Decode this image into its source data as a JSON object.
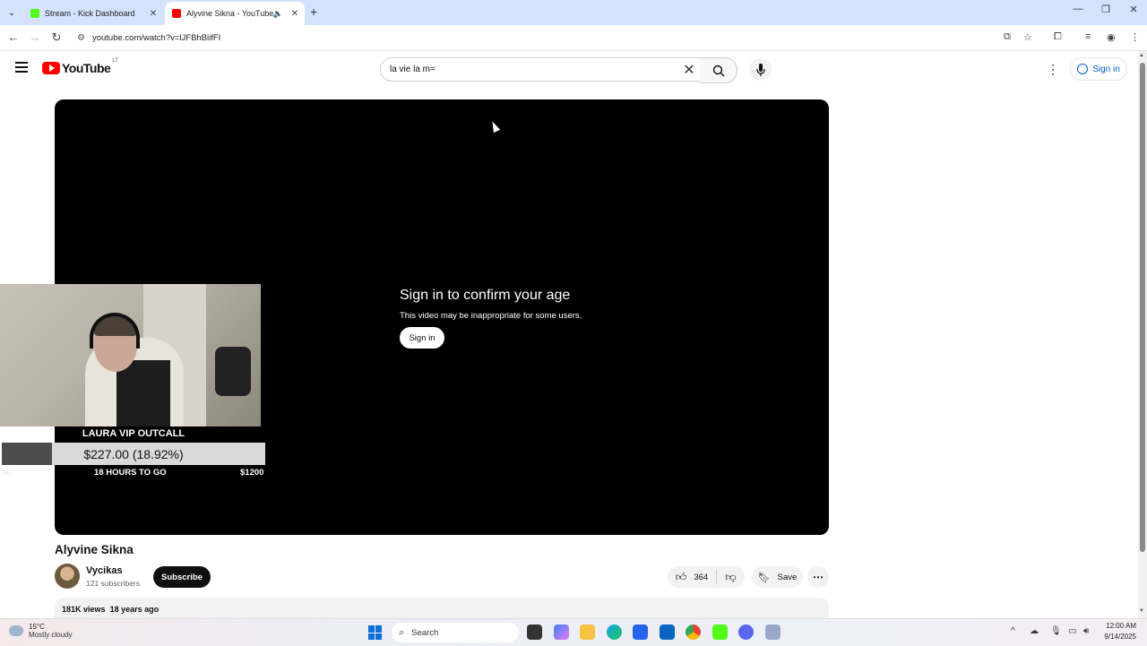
{
  "browser": {
    "tabs": [
      {
        "title": "Stream - Kick Dashboard",
        "favicon_color": "#53fc18"
      },
      {
        "title": "Alyvine Sikna - YouTube",
        "favicon_color": "#ff0000"
      }
    ],
    "url": "youtube.com/watch?v=lJFBhBiifFI"
  },
  "youtube": {
    "logo_text": "YouTube",
    "country_code": "LT",
    "search_query": "la vie la m=",
    "sign_in": "Sign in"
  },
  "player": {
    "age_title": "Sign in to confirm your age",
    "age_subtitle": "This video may be inappropriate for some users.",
    "age_button": "Sign in"
  },
  "overlay": {
    "goal_name": "LAURA VIP OUTCALL",
    "goal_amount": "$227.00 (18.92%)",
    "goal_progress": 0.1892,
    "time_left": "18 HOURS TO GO",
    "goal_target": "$1200",
    "goal_start": "$0"
  },
  "video": {
    "title": "Alyvine Sikna",
    "channel": "Vycikas",
    "subscribers": "121 subscribers",
    "subscribe": "Subscribe",
    "likes": "364",
    "save": "Save",
    "views": "181K views",
    "age": "18 years ago"
  },
  "taskbar": {
    "temperature": "15°C",
    "weather": "Mostly cloudy",
    "search": "Search",
    "time": "12:00 AM",
    "date": "9/14/2025"
  }
}
